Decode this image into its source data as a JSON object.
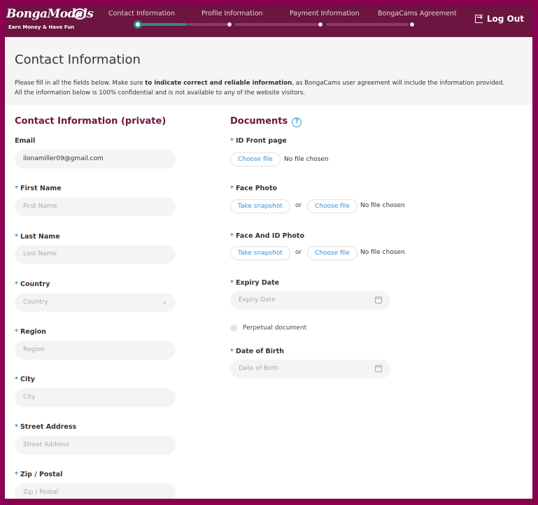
{
  "header": {
    "logo_text": "BongaModels",
    "logo_tagline": "Earn Money & Have Fun",
    "steps": [
      {
        "label": "Contact Information",
        "state": "active"
      },
      {
        "label": "Profile Information",
        "state": "pending"
      },
      {
        "label": "Payment Information",
        "state": "pending"
      },
      {
        "label": "BongaCams Agreement",
        "state": "pending"
      }
    ],
    "progress_fraction_step1": 0.5,
    "logout_label": "Log Out",
    "colors": {
      "header_bg": "#6b1540",
      "frame": "#8a0050",
      "progress": "#27937a"
    }
  },
  "intro": {
    "title": "Contact Information",
    "line1_pre": "Please fill in all the fields below. Make sure ",
    "line1_bold": "to indicate correct and reliable information",
    "line1_post": ", as BongaCams user agreement will include the information provided.",
    "line2": "All the information below is 100% confidential and is not available to any of the website visitors."
  },
  "contact": {
    "title": "Contact Information (private)",
    "required_mark": "*",
    "fields": {
      "email": {
        "label": "Email",
        "value": "ilonamiller09@gmail.com"
      },
      "first_name": {
        "label": "First Name",
        "placeholder": "First Name"
      },
      "last_name": {
        "label": "Last Name",
        "placeholder": "Last Name"
      },
      "country": {
        "label": "Country",
        "placeholder": "Country"
      },
      "region": {
        "label": "Region",
        "placeholder": "Region"
      },
      "city": {
        "label": "City",
        "placeholder": "City"
      },
      "street": {
        "label": "Street Address",
        "placeholder": "Street Address"
      },
      "zip": {
        "label": "Zip / Postal",
        "placeholder": "Zip / Postal"
      }
    }
  },
  "documents": {
    "title": "Documents",
    "help": "?",
    "id_front": {
      "label": "ID Front page",
      "choose": "Choose file",
      "status": "No file chosen"
    },
    "face_photo": {
      "label": "Face Photo",
      "snapshot": "Take snapshot",
      "or": "or",
      "choose": "Choose file",
      "status": "No file chosen"
    },
    "face_id": {
      "label": "Face And ID Photo",
      "snapshot": "Take snapshot",
      "or": "or",
      "choose": "Choose file",
      "status": "No file chosen"
    },
    "expiry": {
      "label": "Expiry Date",
      "placeholder": "Expiry Date"
    },
    "perpetual": {
      "label": "Perpetual document",
      "checked": false
    },
    "dob": {
      "label": "Date of Birth",
      "placeholder": "Date of Birth"
    }
  }
}
